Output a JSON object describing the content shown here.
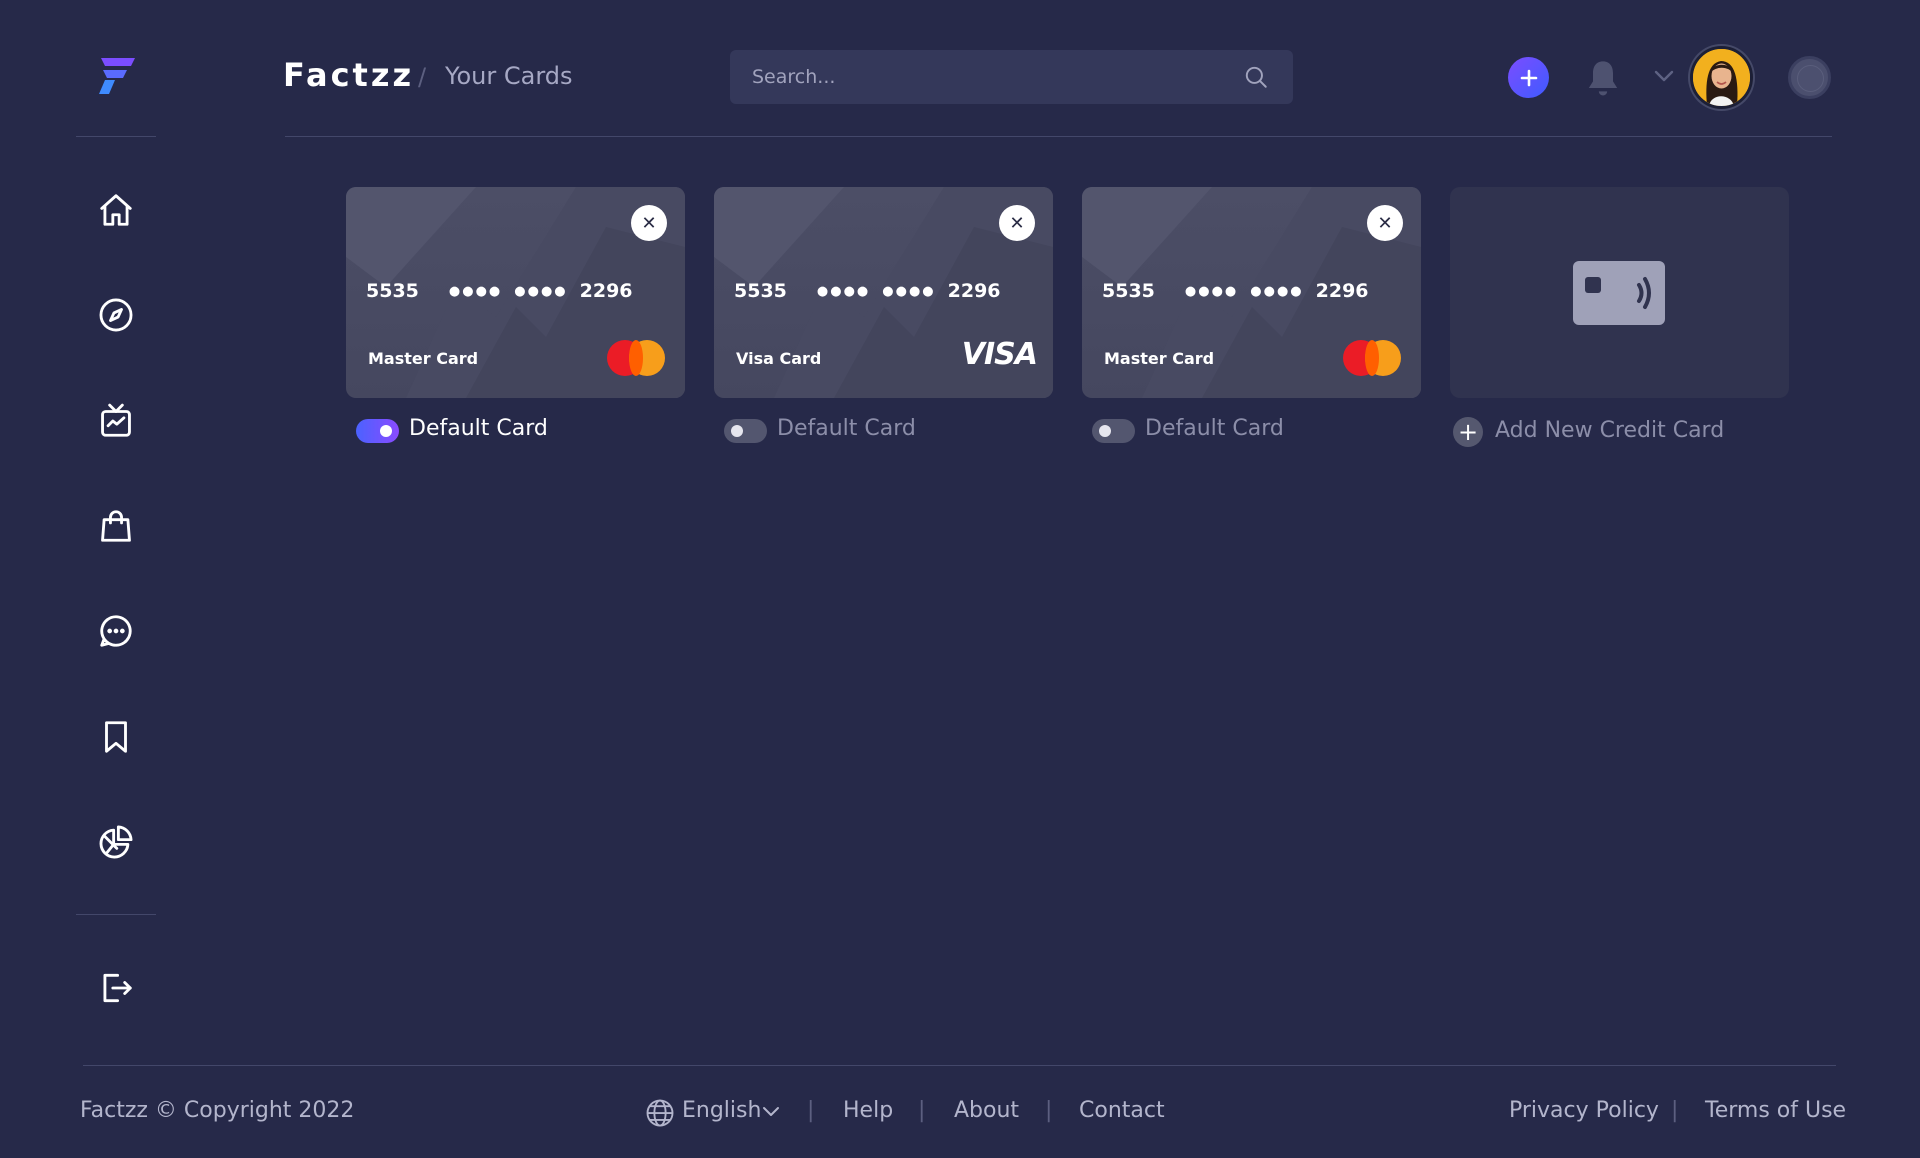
{
  "app": {
    "brand": "Factzz",
    "crumb_separator": "/",
    "page": "Your Cards"
  },
  "search": {
    "placeholder": "Search..."
  },
  "sidebar": {
    "items": [
      {
        "name": "home",
        "icon": "home-icon"
      },
      {
        "name": "explore",
        "icon": "compass-icon"
      },
      {
        "name": "tv",
        "icon": "tv-icon"
      },
      {
        "name": "shop",
        "icon": "shopping-bag-icon"
      },
      {
        "name": "messages",
        "icon": "chat-icon"
      },
      {
        "name": "saved",
        "icon": "bookmark-icon"
      },
      {
        "name": "analytics",
        "icon": "pie-chart-icon"
      }
    ],
    "logout_icon": "logout-icon"
  },
  "cards": [
    {
      "first": "5535",
      "masked1": "●●●●",
      "masked2": "●●●●",
      "last": "2296",
      "type": "Master Card",
      "brand": "mastercard",
      "default": true,
      "default_label": "Default Card"
    },
    {
      "first": "5535",
      "masked1": "●●●●",
      "masked2": "●●●●",
      "last": "2296",
      "type": "Visa Card",
      "brand": "visa",
      "brand_text": "VISA",
      "default": false,
      "default_label": "Default Card"
    },
    {
      "first": "5535",
      "masked1": "●●●●",
      "masked2": "●●●●",
      "last": "2296",
      "type": "Master Card",
      "brand": "mastercard",
      "default": false,
      "default_label": "Default Card"
    }
  ],
  "add_card": {
    "label": "Add New Credit Card",
    "plus": "+"
  },
  "close_glyph": "✕",
  "footer": {
    "copyright": "Factzz © Copyright 2022",
    "language": "English",
    "links": [
      "Help",
      "About",
      "Contact"
    ],
    "legal": [
      "Privacy Policy",
      "Terms of Use"
    ],
    "separator": "|"
  },
  "colors": {
    "background": "#262949",
    "accent_start": "#4b62ff",
    "accent_end": "#8a4bff",
    "card": "#4a4c64"
  }
}
